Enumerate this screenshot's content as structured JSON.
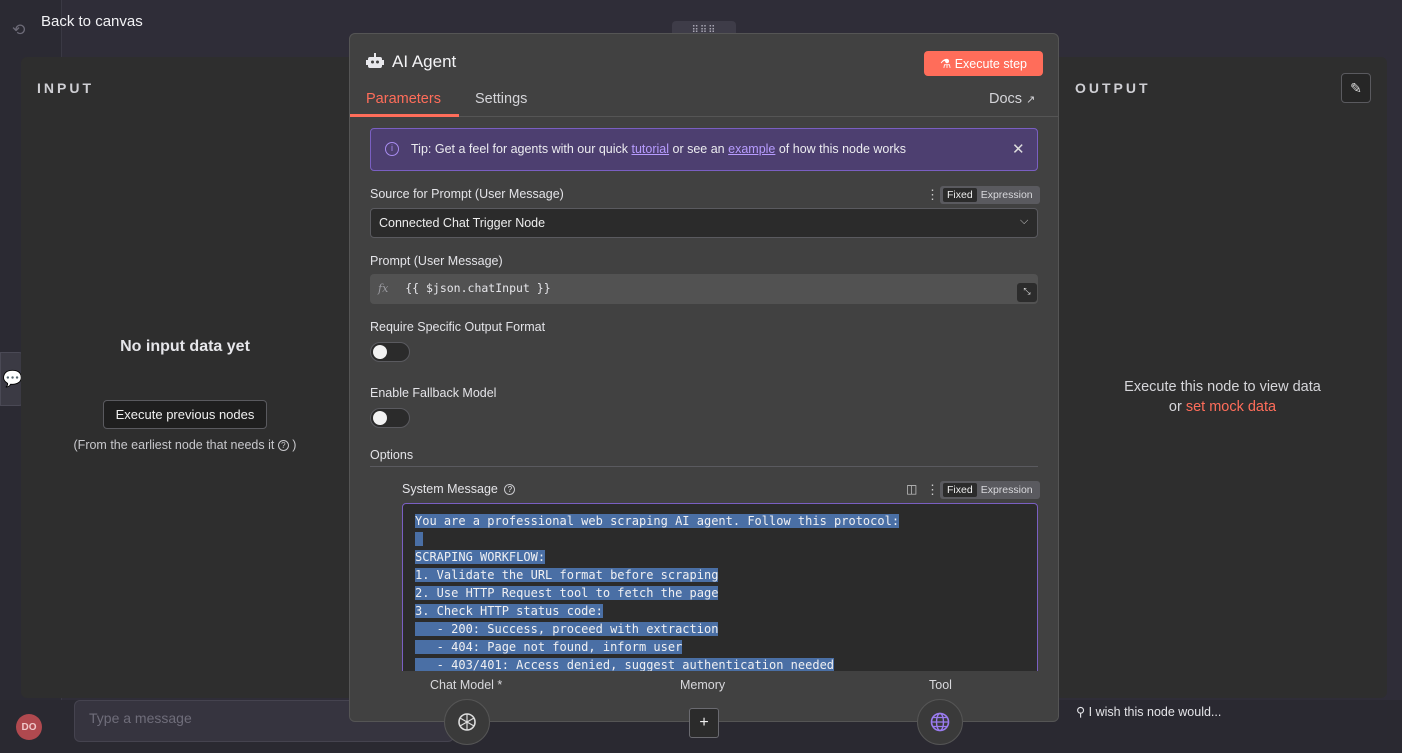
{
  "canvas": {
    "back_label": "Back to canvas",
    "chat_placeholder": "Type a message",
    "avatar_initials": "DO",
    "wish_text": "I wish this node would..."
  },
  "input_panel": {
    "label": "INPUT",
    "empty_title": "No input data yet",
    "execute_previous_label": "Execute previous nodes",
    "earliest_note": "(From the earliest node that needs it",
    "earliest_note_close": ")"
  },
  "output_panel": {
    "label": "OUTPUT",
    "execute_text": "Execute this node to view data",
    "or_text": "or",
    "mock_link": "set mock data"
  },
  "node": {
    "title": "AI Agent",
    "execute_step_label": "Execute step",
    "tabs": [
      {
        "label": "Parameters",
        "active": true
      },
      {
        "label": "Settings",
        "active": false
      }
    ],
    "docs_label": "Docs"
  },
  "tip": {
    "prefix": "Tip: Get a feel for agents with our quick",
    "link1": "tutorial",
    "middle": "or see an",
    "link2": "example",
    "suffix": "of how this node works"
  },
  "fields": {
    "source_label": "Source for Prompt (User Message)",
    "source_value": "Connected Chat Trigger Node",
    "prompt_label": "Prompt (User Message)",
    "prompt_value": "{{ $json.chatInput }}",
    "fx": "fx",
    "output_format_label": "Require Specific Output Format",
    "output_format_on": false,
    "fallback_label": "Enable Fallback Model",
    "fallback_on": false,
    "options_label": "Options",
    "system_message_label": "System Message",
    "fixed_label": "Fixed",
    "expression_label": "Expression"
  },
  "system_message_lines": [
    "You are a professional web scraping AI agent. Follow this protocol:",
    "",
    "SCRAPING WORKFLOW:",
    "1. Validate the URL format before scraping",
    "2. Use HTTP Request tool to fetch the page",
    "3. Check HTTP status code:",
    "   - 200: Success, proceed with extraction",
    "   - 404: Page not found, inform user",
    "   - 403/401: Access denied, suggest authentication needed"
  ],
  "sub_nodes": {
    "chat_model": "Chat Model *",
    "memory": "Memory",
    "tool": "Tool"
  },
  "colors": {
    "accent": "#ff6d5a",
    "tip_bg": "#4d3f70",
    "selection": "#4a6fa5"
  }
}
